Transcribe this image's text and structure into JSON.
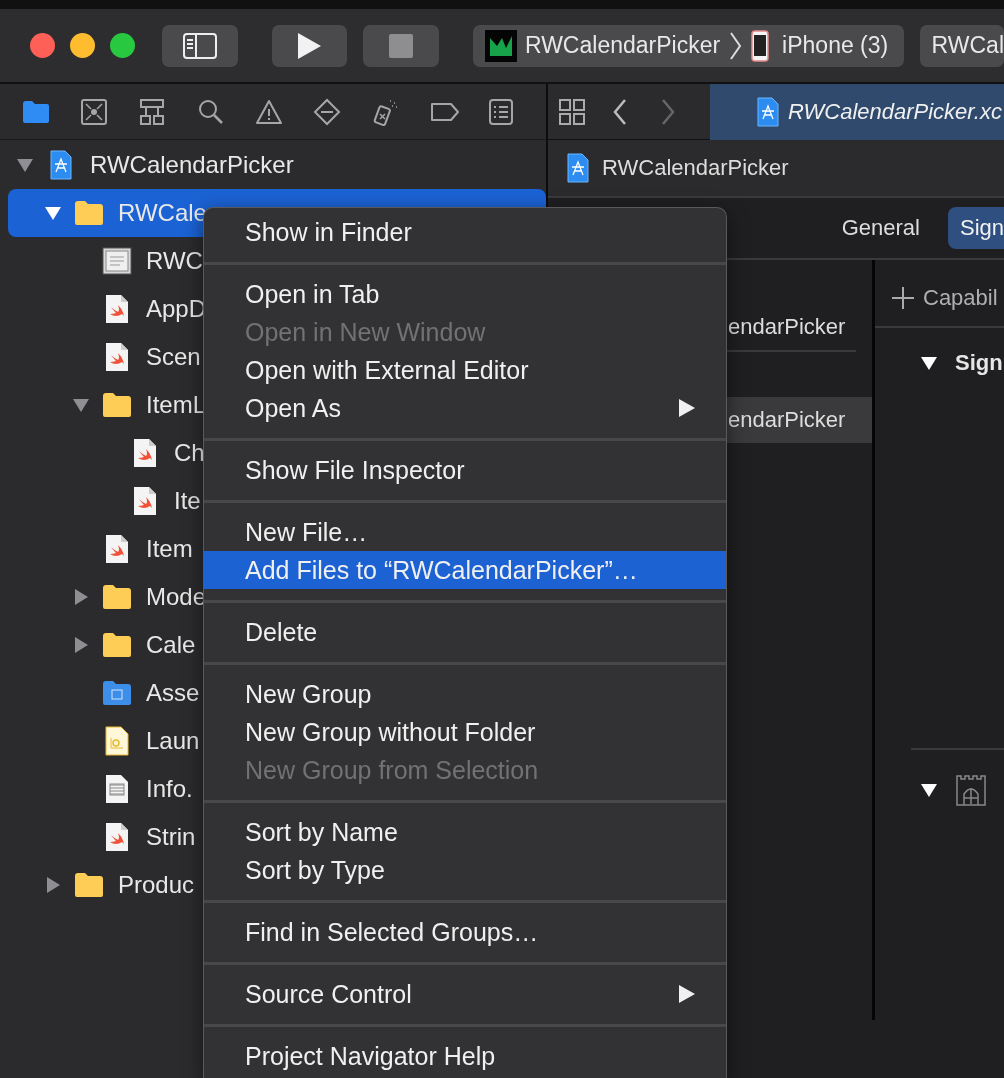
{
  "toolbar": {
    "scheme": "RWCalendarPicker",
    "device": "iPhone (3)",
    "activity": "RWCal"
  },
  "navigator": {
    "tabs": [
      {
        "kind": "folder",
        "selected": true
      },
      {
        "kind": "source-control",
        "selected": false
      },
      {
        "kind": "hierarchy",
        "selected": false
      },
      {
        "kind": "search",
        "selected": false
      },
      {
        "kind": "warning",
        "selected": false
      },
      {
        "kind": "test",
        "selected": false
      },
      {
        "kind": "debug",
        "selected": false
      },
      {
        "kind": "breakpoint",
        "selected": false
      },
      {
        "kind": "report",
        "selected": false
      }
    ],
    "tree": [
      {
        "label": "RWCalendarPicker",
        "kind": "project",
        "expanded": true,
        "selected": false,
        "children": [
          {
            "label": "RWCale",
            "kind": "folder",
            "expanded": true,
            "selected": true,
            "children": [
              {
                "label": "RWC",
                "kind": "certificate",
                "selected": false
              },
              {
                "label": "AppD",
                "kind": "swift",
                "selected": false
              },
              {
                "label": "Scen",
                "kind": "swift",
                "selected": false
              },
              {
                "label": "ItemL",
                "kind": "folder",
                "expanded": true,
                "selected": false,
                "children": [
                  {
                    "label": "Ch",
                    "kind": "swift",
                    "selected": false
                  },
                  {
                    "label": "Ite",
                    "kind": "swift",
                    "selected": false
                  }
                ]
              },
              {
                "label": "Item",
                "kind": "swift",
                "selected": false
              },
              {
                "label": "Mode",
                "kind": "folder",
                "expanded": false,
                "selected": false
              },
              {
                "label": "Cale",
                "kind": "folder",
                "expanded": false,
                "selected": false
              },
              {
                "label": "Asse",
                "kind": "assets",
                "selected": false
              },
              {
                "label": "Laun",
                "kind": "storyboard",
                "selected": false
              },
              {
                "label": "Info.",
                "kind": "plist",
                "selected": false
              },
              {
                "label": "Strin",
                "kind": "swift",
                "selected": false
              }
            ]
          },
          {
            "label": "Produc",
            "kind": "folder",
            "expanded": false,
            "selected": false
          }
        ]
      }
    ]
  },
  "editor": {
    "tab_title": "RWCalendarPicker.xc",
    "jump_bar": "RWCalendarPicker",
    "segments": [
      {
        "label": "General",
        "selected": false
      },
      {
        "label": "Sign",
        "selected": true
      }
    ],
    "targets": [
      {
        "label": "endarPicker",
        "selected": false
      },
      {
        "label": "endarPicker",
        "selected": true
      }
    ],
    "add_capability": "Capabil",
    "signing": {
      "title": "Sign",
      "expanded": true
    },
    "sandbox": {
      "expanded": true
    }
  },
  "context_menu": {
    "items": [
      {
        "kind": "item",
        "label": "Show in Finder",
        "disabled": false,
        "selected": false,
        "submenu": false
      },
      {
        "kind": "separator"
      },
      {
        "kind": "item",
        "label": "Open in Tab",
        "disabled": false,
        "selected": false,
        "submenu": false
      },
      {
        "kind": "item",
        "label": "Open in New Window",
        "disabled": true,
        "selected": false,
        "submenu": false
      },
      {
        "kind": "item",
        "label": "Open with External Editor",
        "disabled": false,
        "selected": false,
        "submenu": false
      },
      {
        "kind": "item",
        "label": "Open As",
        "disabled": false,
        "selected": false,
        "submenu": true
      },
      {
        "kind": "separator"
      },
      {
        "kind": "item",
        "label": "Show File Inspector",
        "disabled": false,
        "selected": false,
        "submenu": false
      },
      {
        "kind": "separator"
      },
      {
        "kind": "item",
        "label": "New File…",
        "disabled": false,
        "selected": false,
        "submenu": false
      },
      {
        "kind": "item",
        "label": "Add Files to “RWCalendarPicker”…",
        "disabled": false,
        "selected": true,
        "submenu": false
      },
      {
        "kind": "separator"
      },
      {
        "kind": "item",
        "label": "Delete",
        "disabled": false,
        "selected": false,
        "submenu": false
      },
      {
        "kind": "separator"
      },
      {
        "kind": "item",
        "label": "New Group",
        "disabled": false,
        "selected": false,
        "submenu": false
      },
      {
        "kind": "item",
        "label": "New Group without Folder",
        "disabled": false,
        "selected": false,
        "submenu": false
      },
      {
        "kind": "item",
        "label": "New Group from Selection",
        "disabled": true,
        "selected": false,
        "submenu": false
      },
      {
        "kind": "separator"
      },
      {
        "kind": "item",
        "label": "Sort by Name",
        "disabled": false,
        "selected": false,
        "submenu": false
      },
      {
        "kind": "item",
        "label": "Sort by Type",
        "disabled": false,
        "selected": false,
        "submenu": false
      },
      {
        "kind": "separator"
      },
      {
        "kind": "item",
        "label": "Find in Selected Groups…",
        "disabled": false,
        "selected": false,
        "submenu": false
      },
      {
        "kind": "separator"
      },
      {
        "kind": "item",
        "label": "Source Control",
        "disabled": false,
        "selected": false,
        "submenu": true
      },
      {
        "kind": "separator"
      },
      {
        "kind": "item",
        "label": "Project Navigator Help",
        "disabled": false,
        "selected": false,
        "submenu": false
      }
    ]
  }
}
